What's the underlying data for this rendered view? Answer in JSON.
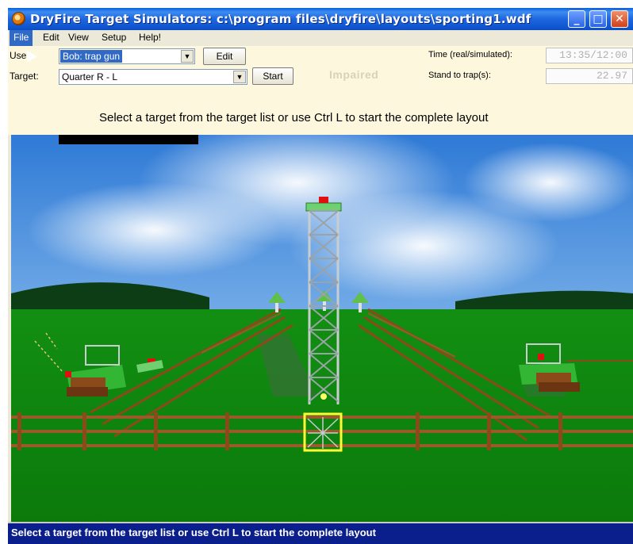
{
  "window": {
    "title": "DryFire Target Simulators: c:\\program files\\dryfire\\layouts\\sporting1.wdf",
    "minimize_glyph": "_",
    "maximize_glyph": "□",
    "close_glyph": "✕"
  },
  "menu": [
    "File",
    "Edit",
    "View",
    "Setup",
    "Help!"
  ],
  "toolbar": {
    "user_label": "User:",
    "user_value": "Bob: trap gun",
    "edit_button": "Edit",
    "target_label": "Target:",
    "target_value": "Quarter R - L",
    "start_button": "Start",
    "impaired_text": "Impaired",
    "time_label": "Time (real/simulated):",
    "time_value": "13:35/12:00",
    "stand_label": "Stand to trap(s):",
    "stand_value": "22.97",
    "hint": "Select a target from the target list or use Ctrl L to start the complete layout"
  },
  "status_bar": {
    "text": "Select a target from the target list or use Ctrl L to start the complete layout"
  },
  "colors": {
    "title_bar": "#1e66e0",
    "toolbar_bg": "#fcf7dd",
    "sky": "#2e7cd8",
    "grass": "#0f8a0f",
    "fence": "#8b4a1a",
    "tower": "#9aa3a8",
    "clay_target": "#e01010",
    "status_bar": "#0a1e8c"
  }
}
